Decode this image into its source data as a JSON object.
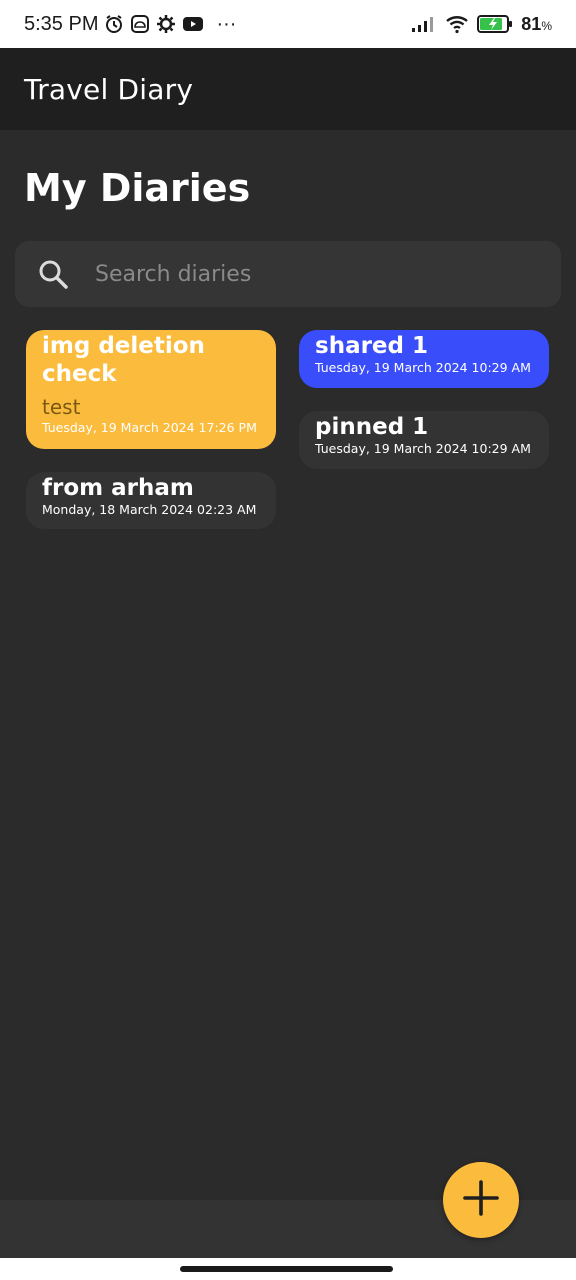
{
  "status_bar": {
    "time": "5:35 PM",
    "notification_icons": [
      "alarm-icon",
      "cloud-icon",
      "settings-icon",
      "youtube-icon",
      "more-icon"
    ],
    "overflow": "···",
    "battery_percent": "81",
    "battery_unit": "%"
  },
  "app_bar": {
    "title": "Travel Diary"
  },
  "page": {
    "title": "My Diaries"
  },
  "search": {
    "placeholder": "Search diaries",
    "icon": "search-icon"
  },
  "diaries": [
    {
      "title_line1": "img deletion",
      "title_line2": "check",
      "body": "test",
      "date": "Tuesday, 19 March 2024 17:26 PM",
      "color": "#fbbb3c"
    },
    {
      "title": "from arham",
      "date": "Monday, 18 March 2024 02:23 AM",
      "color": "#333333"
    },
    {
      "title": "shared 1",
      "date": "Tuesday, 19 March 2024 10:29 AM",
      "color": "#3a4dfb"
    },
    {
      "title": "pinned 1",
      "date": "Tuesday, 19 March 2024 10:29 AM",
      "color": "#333333"
    }
  ],
  "fab": {
    "icon": "plus-icon",
    "color": "#fbbb3c"
  },
  "colors": {
    "background": "#2b2b2b",
    "app_bar": "#1f1f1f",
    "accent_yellow": "#fbbb3c",
    "accent_blue": "#3a4dfb"
  }
}
